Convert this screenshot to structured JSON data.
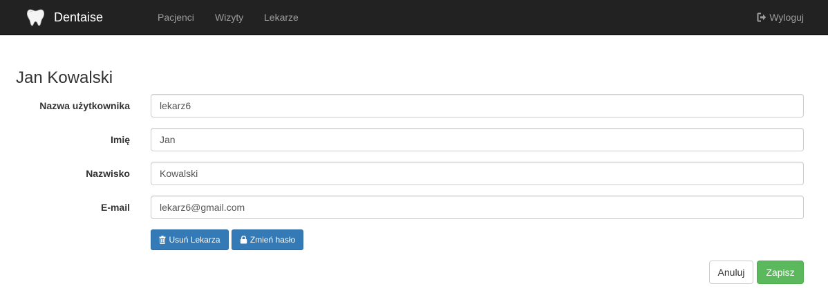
{
  "navbar": {
    "brand": "Dentaise",
    "brand_icon": "tooth-icon",
    "links": [
      "Pacjenci",
      "Wizyty",
      "Lekarze"
    ],
    "logout_label": "Wyloguj",
    "logout_icon": "log-out-icon"
  },
  "page": {
    "title": "Jan Kowalski"
  },
  "form": {
    "fields": [
      {
        "label": "Nazwa użytkownika",
        "value": "lekarz6"
      },
      {
        "label": "Imię",
        "value": "Jan"
      },
      {
        "label": "Nazwisko",
        "value": "Kowalski"
      },
      {
        "label": "E-mail",
        "value": "lekarz6@gmail.com"
      }
    ],
    "delete_label": "Usuń Lekarza",
    "delete_icon": "trash-icon",
    "change_password_label": "Zmień hasło",
    "change_password_icon": "lock-icon",
    "cancel_label": "Anuluj",
    "save_label": "Zapisz"
  },
  "colors": {
    "navbar_bg": "#222222",
    "primary": "#337ab7",
    "success": "#5cb85c"
  }
}
